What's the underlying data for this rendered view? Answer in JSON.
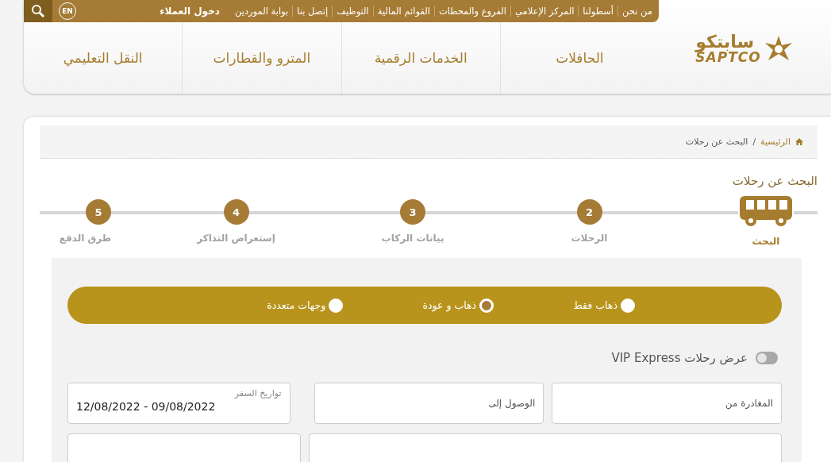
{
  "top_links": [
    "من نحن",
    "أسطولنا",
    "المركز الإعلامي",
    "الفروع والمحطات",
    "القوائم المالية",
    "التوظيف",
    "إتصل بنا",
    "بوابة الموردين"
  ],
  "login": "دخول العملاء",
  "language": "EN",
  "logo": {
    "arabic": "سابتكو",
    "latin": "SAPTCO"
  },
  "nav": [
    "الحافلات",
    "الخدمات الرقمية",
    "المترو والقطارات",
    "النقل التعليمي"
  ],
  "breadcrumb": {
    "home": "الرئيسية",
    "separator": "/",
    "current": "البحث عن رحلات"
  },
  "page_title": "البحث عن رحلات",
  "steps": [
    {
      "kind": "icon",
      "label": "البحث",
      "selected": true
    },
    {
      "kind": "number",
      "number": "2",
      "label": "الرحلات",
      "selected": false
    },
    {
      "kind": "number",
      "number": "3",
      "label": "بيانات الركاب",
      "selected": false
    },
    {
      "kind": "number",
      "number": "4",
      "label": "إستعراض التذاكر",
      "selected": false
    },
    {
      "kind": "number",
      "number": "5",
      "label": "طرق الدفع",
      "selected": false
    }
  ],
  "trip_types": [
    {
      "label": "ذهاب فقط",
      "selected": false
    },
    {
      "label": "ذهاب و عودة",
      "selected": true
    },
    {
      "label": "وجهات متعددة",
      "selected": false
    }
  ],
  "vip_toggle": {
    "label": "عرض رحلات VIP Express",
    "on": false
  },
  "fields": [
    {
      "placeholder": "المغادرة من"
    },
    {
      "placeholder": "الوصول إلى"
    },
    {
      "label": "تواريخ السفر",
      "value": "12/08/2022 - 09/08/2022"
    }
  ]
}
